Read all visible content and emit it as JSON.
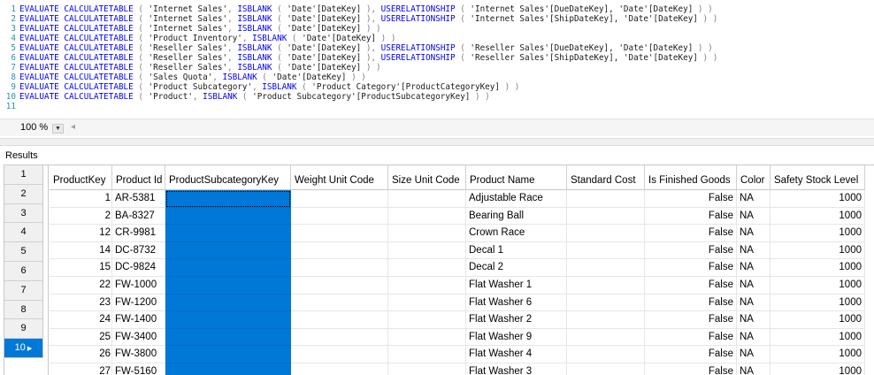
{
  "editor": {
    "lines": [
      {
        "n": "1",
        "tokens": [
          [
            "kw",
            "EVALUATE CALCULATETABLE"
          ],
          [
            "p",
            " ( "
          ],
          [
            "s",
            "'Internet Sales'"
          ],
          [
            "p",
            ", "
          ],
          [
            "kw",
            "ISBLANK"
          ],
          [
            "p",
            " ( "
          ],
          [
            "s",
            "'Date'[DateKey]"
          ],
          [
            "p",
            " ), "
          ],
          [
            "kw",
            "USERELATIONSHIP"
          ],
          [
            "p",
            " ( "
          ],
          [
            "s",
            "'Internet Sales'[DueDateKey], 'Date'[DateKey]"
          ],
          [
            "p",
            " ) )"
          ]
        ]
      },
      {
        "n": "2",
        "tokens": [
          [
            "kw",
            "EVALUATE CALCULATETABLE"
          ],
          [
            "p",
            " ( "
          ],
          [
            "s",
            "'Internet Sales'"
          ],
          [
            "p",
            ", "
          ],
          [
            "kw",
            "ISBLANK"
          ],
          [
            "p",
            " ( "
          ],
          [
            "s",
            "'Date'[DateKey]"
          ],
          [
            "p",
            " ), "
          ],
          [
            "kw",
            "USERELATIONSHIP"
          ],
          [
            "p",
            " ( "
          ],
          [
            "s",
            "'Internet Sales'[ShipDateKey], 'Date'[DateKey]"
          ],
          [
            "p",
            " ) )"
          ]
        ]
      },
      {
        "n": "3",
        "tokens": [
          [
            "kw",
            "EVALUATE CALCULATETABLE"
          ],
          [
            "p",
            " ( "
          ],
          [
            "s",
            "'Internet Sales'"
          ],
          [
            "p",
            ", "
          ],
          [
            "kw",
            "ISBLANK"
          ],
          [
            "p",
            " ( "
          ],
          [
            "s",
            "'Date'[DateKey]"
          ],
          [
            "p",
            " ) )"
          ]
        ]
      },
      {
        "n": "4",
        "tokens": [
          [
            "kw",
            "EVALUATE CALCULATETABLE"
          ],
          [
            "p",
            " ( "
          ],
          [
            "s",
            "'Product Inventory'"
          ],
          [
            "p",
            ", "
          ],
          [
            "kw",
            "ISBLANK"
          ],
          [
            "p",
            " ( "
          ],
          [
            "s",
            "'Date'[DateKey]"
          ],
          [
            "p",
            " ) )"
          ]
        ]
      },
      {
        "n": "5",
        "tokens": [
          [
            "kw",
            "EVALUATE CALCULATETABLE"
          ],
          [
            "p",
            " ( "
          ],
          [
            "s",
            "'Reseller Sales'"
          ],
          [
            "p",
            ", "
          ],
          [
            "kw",
            "ISBLANK"
          ],
          [
            "p",
            " ( "
          ],
          [
            "s",
            "'Date'[DateKey]"
          ],
          [
            "p",
            " ), "
          ],
          [
            "kw",
            "USERELATIONSHIP"
          ],
          [
            "p",
            " ( "
          ],
          [
            "s",
            "'Reseller Sales'[DueDateKey], 'Date'[DateKey]"
          ],
          [
            "p",
            " ) )"
          ]
        ]
      },
      {
        "n": "6",
        "tokens": [
          [
            "kw",
            "EVALUATE CALCULATETABLE"
          ],
          [
            "p",
            " ( "
          ],
          [
            "s",
            "'Reseller Sales'"
          ],
          [
            "p",
            ", "
          ],
          [
            "kw",
            "ISBLANK"
          ],
          [
            "p",
            " ( "
          ],
          [
            "s",
            "'Date'[DateKey]"
          ],
          [
            "p",
            " ), "
          ],
          [
            "kw",
            "USERELATIONSHIP"
          ],
          [
            "p",
            " ( "
          ],
          [
            "s",
            "'Reseller Sales'[ShipDateKey], 'Date'[DateKey]"
          ],
          [
            "p",
            " ) )"
          ]
        ]
      },
      {
        "n": "7",
        "tokens": [
          [
            "kw",
            "EVALUATE CALCULATETABLE"
          ],
          [
            "p",
            " ( "
          ],
          [
            "s",
            "'Reseller Sales'"
          ],
          [
            "p",
            ", "
          ],
          [
            "kw",
            "ISBLANK"
          ],
          [
            "p",
            " ( "
          ],
          [
            "s",
            "'Date'[DateKey]"
          ],
          [
            "p",
            " ) )"
          ]
        ]
      },
      {
        "n": "8",
        "tokens": [
          [
            "kw",
            "EVALUATE CALCULATETABLE"
          ],
          [
            "p",
            " ( "
          ],
          [
            "s",
            "'Sales Quota'"
          ],
          [
            "p",
            ", "
          ],
          [
            "kw",
            "ISBLANK"
          ],
          [
            "p",
            " ( "
          ],
          [
            "s",
            "'Date'[DateKey]"
          ],
          [
            "p",
            " ) )"
          ]
        ]
      },
      {
        "n": "9",
        "tokens": [
          [
            "kw",
            "EVALUATE CALCULATETABLE"
          ],
          [
            "p",
            " ( "
          ],
          [
            "s",
            "'Product Subcategory'"
          ],
          [
            "p",
            ", "
          ],
          [
            "kw",
            "ISBLANK"
          ],
          [
            "p",
            " ( "
          ],
          [
            "s",
            "'Product Category'[ProductCategoryKey]"
          ],
          [
            "p",
            " ) )"
          ]
        ]
      },
      {
        "n": "10",
        "tokens": [
          [
            "kw",
            "EVALUATE CALCULATETABLE"
          ],
          [
            "p",
            " ( "
          ],
          [
            "s",
            "'Product'"
          ],
          [
            "p",
            ", "
          ],
          [
            "kw",
            "ISBLANK"
          ],
          [
            "p",
            " ( "
          ],
          [
            "s",
            "'Product Subcategory'[ProductSubcategoryKey]"
          ],
          [
            "p",
            " ) )"
          ]
        ]
      },
      {
        "n": "11",
        "tokens": []
      }
    ]
  },
  "zoom": {
    "value": "100 %",
    "dropdown_icon": "triangle-down-icon",
    "scroll_icon": "scroll-left-icon"
  },
  "results": {
    "tab_label": "Results",
    "columns": [
      "ProductKey",
      "Product Id",
      "ProductSubcategoryKey",
      "Weight Unit Code",
      "Size Unit Code",
      "Product Name",
      "Standard Cost",
      "Is Finished Goods",
      "Color",
      "Safety Stock Level"
    ],
    "row_numbers": [
      "1",
      "2",
      "3",
      "4",
      "5",
      "6",
      "7",
      "8",
      "9",
      "10"
    ],
    "selected_row_marker": "▶",
    "rows": [
      [
        "1",
        "AR-5381",
        "",
        "",
        "",
        "Adjustable Race",
        "",
        "False",
        "NA",
        "1000"
      ],
      [
        "2",
        "BA-8327",
        "",
        "",
        "",
        "Bearing Ball",
        "",
        "False",
        "NA",
        "1000"
      ],
      [
        "12",
        "CR-9981",
        "",
        "",
        "",
        "Crown Race",
        "",
        "False",
        "NA",
        "1000"
      ],
      [
        "14",
        "DC-8732",
        "",
        "",
        "",
        "Decal 1",
        "",
        "False",
        "NA",
        "1000"
      ],
      [
        "15",
        "DC-9824",
        "",
        "",
        "",
        "Decal 2",
        "",
        "False",
        "NA",
        "1000"
      ],
      [
        "22",
        "FW-1000",
        "",
        "",
        "",
        "Flat Washer 1",
        "",
        "False",
        "NA",
        "1000"
      ],
      [
        "23",
        "FW-1200",
        "",
        "",
        "",
        "Flat Washer 6",
        "",
        "False",
        "NA",
        "1000"
      ],
      [
        "24",
        "FW-1400",
        "",
        "",
        "",
        "Flat Washer 2",
        "",
        "False",
        "NA",
        "1000"
      ],
      [
        "25",
        "FW-3400",
        "",
        "",
        "",
        "Flat Washer 9",
        "",
        "False",
        "NA",
        "1000"
      ],
      [
        "26",
        "FW-3800",
        "",
        "",
        "",
        "Flat Washer 4",
        "",
        "False",
        "NA",
        "1000"
      ],
      [
        "27",
        "FW-5160",
        "",
        "",
        "",
        "Flat Washer 3",
        "",
        "False",
        "NA",
        "1000"
      ]
    ]
  },
  "colors": {
    "selection": "#0078d7",
    "keyword": "#0000ff",
    "line_number": "#2b91af"
  }
}
